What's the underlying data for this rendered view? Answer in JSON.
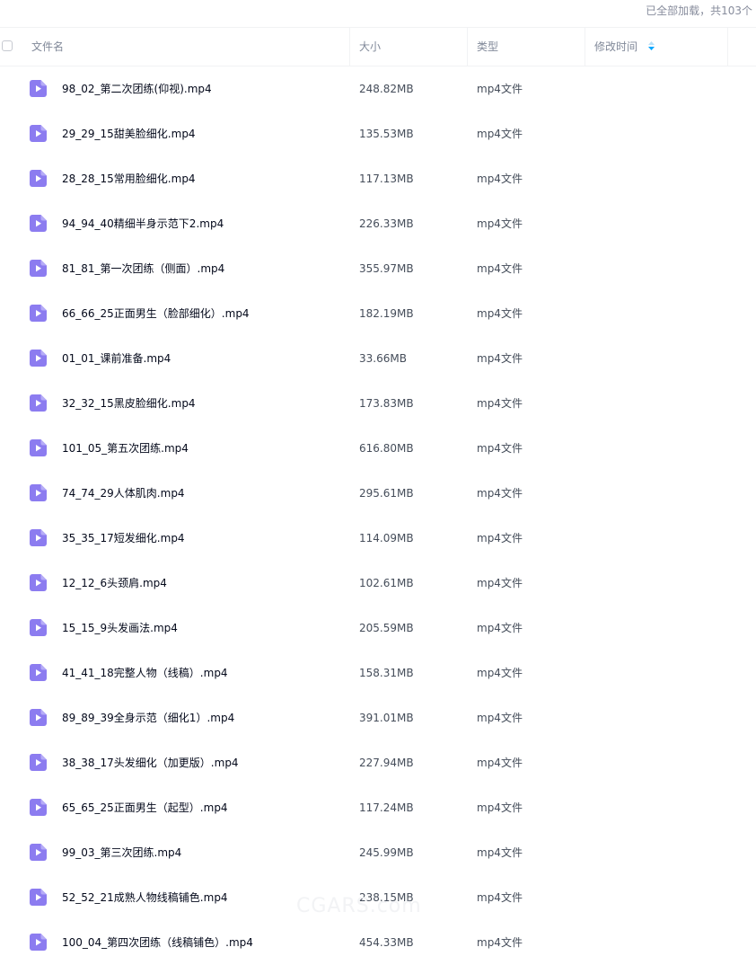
{
  "status": {
    "text": "已全部加载，共103个"
  },
  "columns": {
    "name": "文件名",
    "size": "大小",
    "type": "类型",
    "modified": "修改时间"
  },
  "icons": {
    "file_icon": "video-file-icon",
    "sort_icon": "sort-icon",
    "accent": "#8c7cf0",
    "sort_color": "#06a7ff"
  },
  "files": [
    {
      "name": "98_02_第二次团练(仰视).mp4",
      "size": "248.82MB",
      "type": "mp4文件"
    },
    {
      "name": "29_29_15甜美脸细化.mp4",
      "size": "135.53MB",
      "type": "mp4文件"
    },
    {
      "name": "28_28_15常用脸细化.mp4",
      "size": "117.13MB",
      "type": "mp4文件"
    },
    {
      "name": "94_94_40精细半身示范下2.mp4",
      "size": "226.33MB",
      "type": "mp4文件"
    },
    {
      "name": "81_81_第一次团练（侧面）.mp4",
      "size": "355.97MB",
      "type": "mp4文件"
    },
    {
      "name": "66_66_25正面男生（脸部细化）.mp4",
      "size": "182.19MB",
      "type": "mp4文件"
    },
    {
      "name": "01_01_课前准备.mp4",
      "size": "33.66MB",
      "type": "mp4文件"
    },
    {
      "name": "32_32_15黑皮脸细化.mp4",
      "size": "173.83MB",
      "type": "mp4文件"
    },
    {
      "name": "101_05_第五次团练.mp4",
      "size": "616.80MB",
      "type": "mp4文件"
    },
    {
      "name": "74_74_29人体肌肉.mp4",
      "size": "295.61MB",
      "type": "mp4文件"
    },
    {
      "name": "35_35_17短发细化.mp4",
      "size": "114.09MB",
      "type": "mp4文件"
    },
    {
      "name": "12_12_6头颈肩.mp4",
      "size": "102.61MB",
      "type": "mp4文件"
    },
    {
      "name": "15_15_9头发画法.mp4",
      "size": "205.59MB",
      "type": "mp4文件"
    },
    {
      "name": "41_41_18完整人物（线稿）.mp4",
      "size": "158.31MB",
      "type": "mp4文件"
    },
    {
      "name": "89_89_39全身示范（细化1）.mp4",
      "size": "391.01MB",
      "type": "mp4文件"
    },
    {
      "name": "38_38_17头发细化（加更版）.mp4",
      "size": "227.94MB",
      "type": "mp4文件"
    },
    {
      "name": "65_65_25正面男生（起型）.mp4",
      "size": "117.24MB",
      "type": "mp4文件"
    },
    {
      "name": "99_03_第三次团练.mp4",
      "size": "245.99MB",
      "type": "mp4文件"
    },
    {
      "name": "52_52_21成熟人物线稿铺色.mp4",
      "size": "238.15MB",
      "type": "mp4文件"
    },
    {
      "name": "100_04_第四次团练（线稿铺色）.mp4",
      "size": "454.33MB",
      "type": "mp4文件"
    }
  ],
  "watermark": {
    "text": "CGARS.com"
  }
}
